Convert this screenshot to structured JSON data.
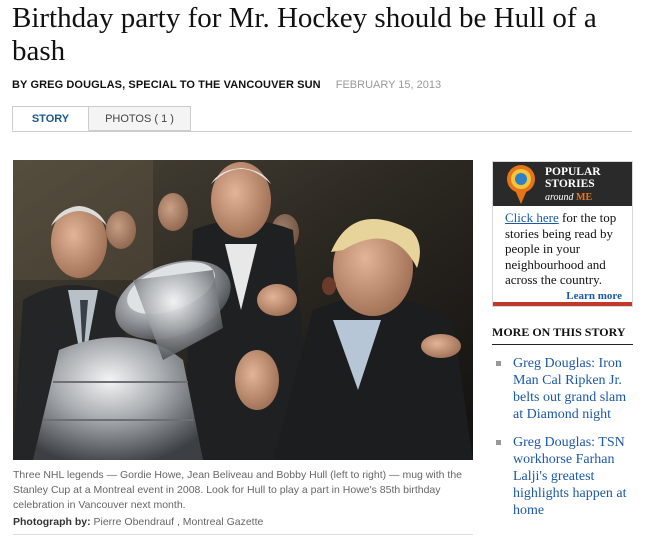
{
  "article": {
    "headline": "Birthday party for Mr. Hockey should be Hull of a bash",
    "byline": "BY GREG DOUGLAS, SPECIAL TO THE VANCOUVER SUN",
    "date": "FEBRUARY 15, 2013"
  },
  "tabs": [
    {
      "label": "STORY",
      "active": true
    },
    {
      "label": "PHOTOS ( 1 )",
      "active": false
    }
  ],
  "photo": {
    "caption": "Three NHL legends — Gordie Howe, Jean Beliveau and Bobby Hull (left to right) — mug with the Stanley Cup at a Montreal event in 2008. Look for Hull to play a part in Howe's 85th birthday celebration in Vancouver next month.",
    "credit_label": "Photograph by:",
    "credit": "Pierre Obendrauf , Montreal Gazette"
  },
  "promo": {
    "title_line1": "POPULAR",
    "title_line2": "STORIES",
    "sub_prefix": "around",
    "sub_me": "ME",
    "link_text": "Click here",
    "body_text": " for the top stories being read by people in your neighbourhood and across the country.",
    "more_label": "Learn more",
    "icon": "map-pin-icon"
  },
  "more_on_story": {
    "heading": "MORE ON THIS STORY",
    "items": [
      "Greg Douglas: Iron Man Cal Ripken Jr. belts out grand slam at Diamond night",
      "Greg Douglas: TSN workhorse Farhan Lalji's greatest highlights happen at home"
    ]
  },
  "colors": {
    "link": "#1c58a8",
    "tab_active": "#1b5a8a",
    "promo_accent": "#e8741a"
  }
}
